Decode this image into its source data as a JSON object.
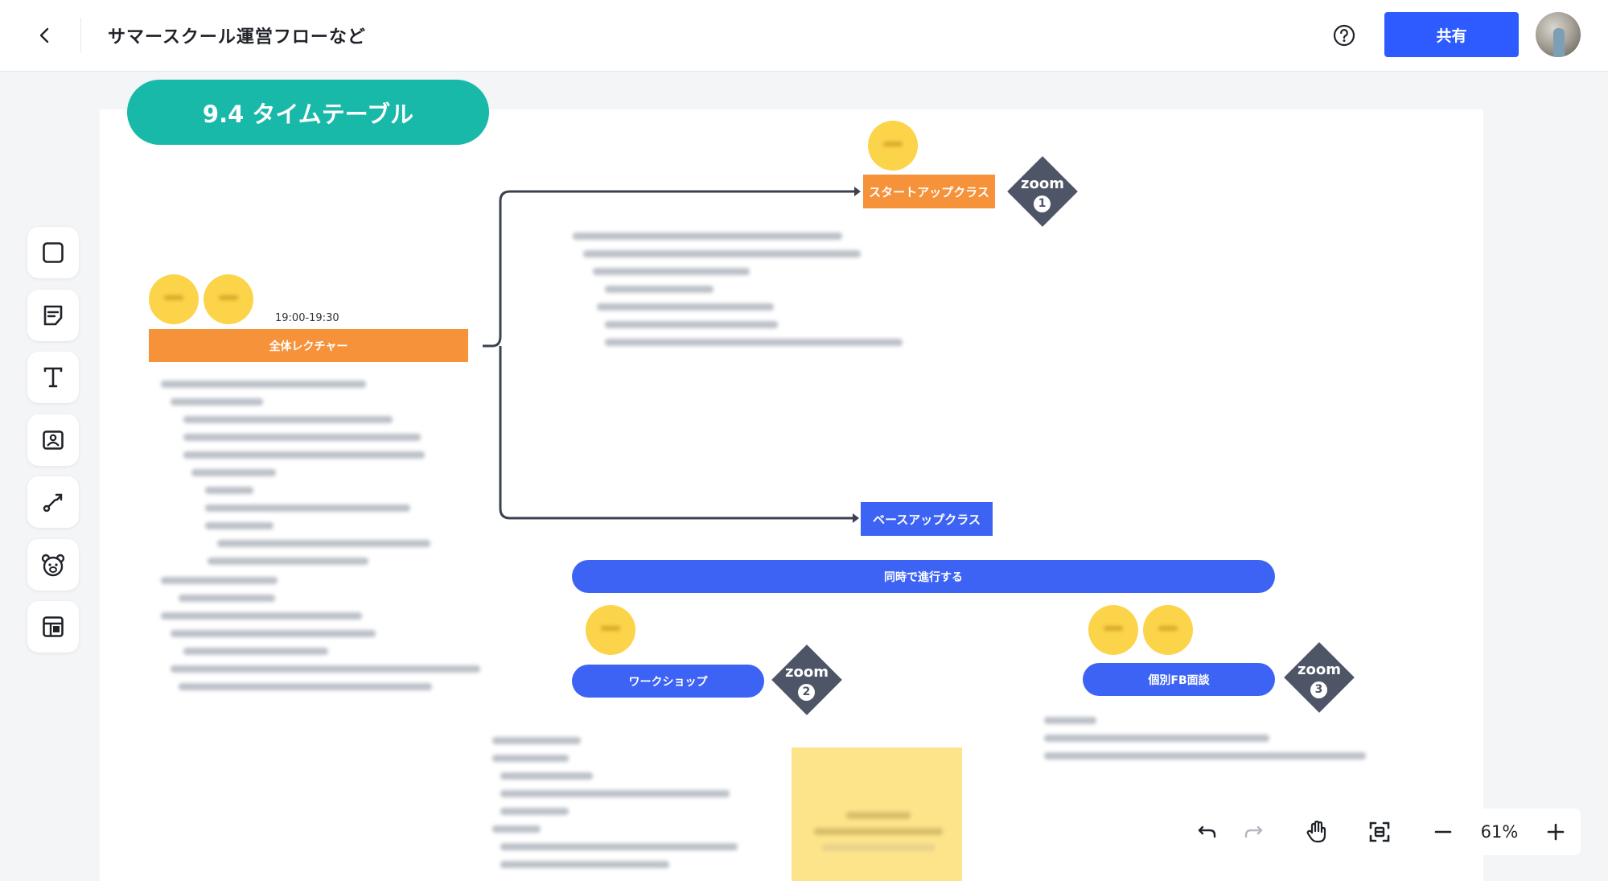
{
  "header": {
    "title": "サマースクール運営フローなど",
    "share_label": "共有"
  },
  "icons": {
    "back": "chevron-left-icon",
    "help": "help-circle-icon",
    "toolbar": [
      "rectangle-icon",
      "sticky-note-icon",
      "text-icon",
      "image-icon",
      "connector-icon",
      "bear-sticker-icon",
      "template-icon"
    ],
    "bottom": [
      "undo-icon",
      "redo-icon",
      "hand-icon",
      "fit-screen-icon",
      "minus-icon",
      "plus-icon"
    ]
  },
  "board": {
    "section_title": "9.4 タイムテーブル",
    "time": "19:00-19:30",
    "nodes": {
      "lecture": "全体レクチャー",
      "startup": "スタートアップクラス",
      "baseup": "ベースアップクラス",
      "parallel": "同時で進行する",
      "workshop": "ワークショップ",
      "fb": "個別FB面談"
    },
    "zoom_label": "zoom",
    "zoom_numbers": [
      "1",
      "2",
      "3"
    ]
  },
  "zoom": {
    "value": "61%"
  },
  "colors": {
    "accent": "#2d5bff",
    "teal": "#19b9aa",
    "orange": "#f5923a",
    "blue_node": "#3d63f4",
    "circle": "#fbd44a",
    "diamond": "#4d5566",
    "sticky": "#fde38a"
  }
}
